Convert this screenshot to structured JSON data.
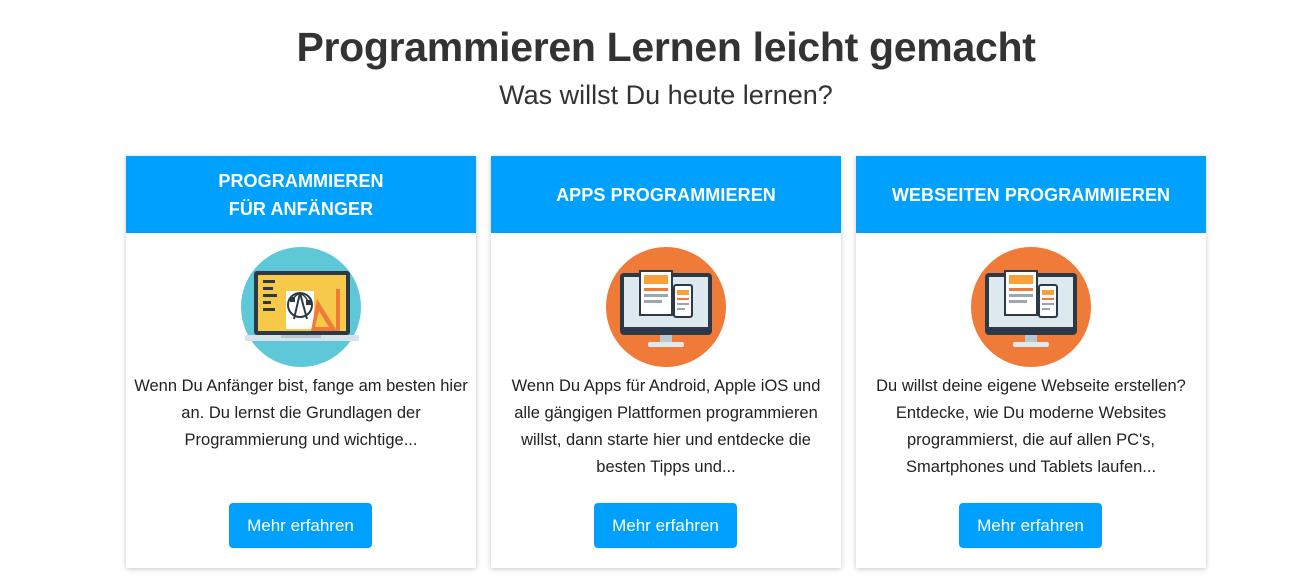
{
  "hero": {
    "title": "Programmieren Lernen leicht gemacht",
    "subtitle": "Was willst Du heute lernen?"
  },
  "colors": {
    "accent": "#00a0ff",
    "teal_circle": "#5ec8d8",
    "orange_circle": "#f07a38"
  },
  "cards": [
    {
      "title": "PROGRAMMIEREN\nFÜR ANFÄNGER",
      "icon": "design-laptop-icon",
      "text": "Wenn Du Anfänger bist, fange am besten hier an. Du lernst die Grundlagen der Programmierung und wichtige...",
      "button": "Mehr erfahren"
    },
    {
      "title": "APPS PROGRAMMIEREN",
      "icon": "responsive-devices-icon",
      "text": "Wenn Du Apps für Android, Apple iOS und alle gängigen Plattformen programmieren willst, dann starte hier und entdecke die besten Tipps und...",
      "button": "Mehr erfahren"
    },
    {
      "title": "WEBSEITEN PROGRAMMIEREN",
      "icon": "responsive-devices-icon",
      "text": "Du willst deine eigene Webseite erstellen? Entdecke, wie Du moderne Websites programmierst, die auf allen PC's, Smartphones und Tablets laufen...",
      "button": "Mehr erfahren"
    }
  ]
}
